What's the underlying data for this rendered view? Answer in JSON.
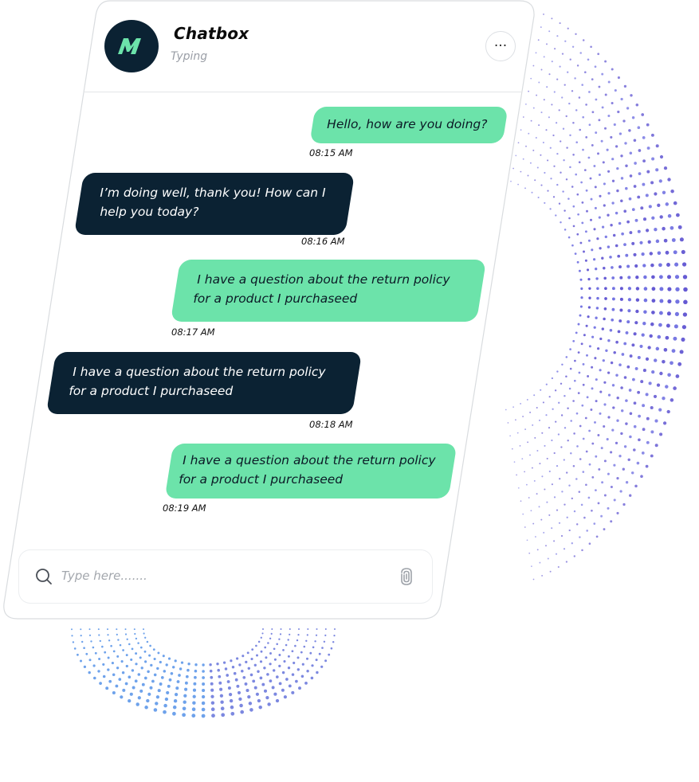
{
  "header": {
    "title": "Chatbox",
    "status": "Typing",
    "avatar_letter": "M",
    "more_label": "···"
  },
  "messages": [
    {
      "sender": "user",
      "text": "Hello, how are you doing?",
      "time": "08:15 AM"
    },
    {
      "sender": "bot",
      "text": "I’m doing well, thank you! How can I\nhelp you today?",
      "time": "08:16 AM"
    },
    {
      "sender": "user",
      "text": " I have a question about the return policy\nfor a product I purchaseed",
      "time": "08:17 AM"
    },
    {
      "sender": "bot",
      "text": " I have a question about the return policy\nfor a product I purchaseed",
      "time": "08:18 AM"
    },
    {
      "sender": "user",
      "text": " I have a question about the return policy\nfor a product I purchaseed",
      "time": "08:19 AM"
    }
  ],
  "composer": {
    "placeholder": "Type here.......",
    "search_icon": "search-icon",
    "attach_icon": "paperclip-icon"
  },
  "colors": {
    "user_bubble": "#6ce3aa",
    "bot_bubble": "#0b2233",
    "avatar_bg": "#0b2233",
    "avatar_mark": "#6ce3aa",
    "dots": "#6b5bd6"
  }
}
